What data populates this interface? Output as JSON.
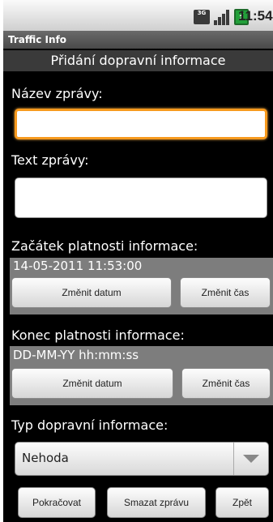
{
  "status_bar": {
    "network": "3G",
    "time": "11:54",
    "icons": [
      "3g-icon",
      "signal-icon",
      "battery-icon"
    ]
  },
  "app": {
    "title": "Traffic Info",
    "heading": "Přidání dopravní informace"
  },
  "form": {
    "name_label": "Název zprávy:",
    "name_value": "",
    "text_label": "Text zprávy:",
    "text_value": "",
    "start": {
      "label": "Začátek platnosti informace:",
      "value": "14-05-2011 11:53:00",
      "change_date": "Změnit datum",
      "change_time": "Změnit čas"
    },
    "end": {
      "label": "Konec platnosti informace:",
      "value": "DD-MM-YY hh:mm:ss",
      "change_date": "Změnit datum",
      "change_time": "Změnit čas"
    },
    "type_label": "Typ dopravní informace:",
    "type_selected": "Nehoda"
  },
  "actions": {
    "continue": "Pokračovat",
    "delete": "Smazat zprávu",
    "back": "Zpět"
  },
  "colors": {
    "focus": "#f79a1e",
    "section_bg": "#7d7d7d",
    "background": "#000000"
  }
}
